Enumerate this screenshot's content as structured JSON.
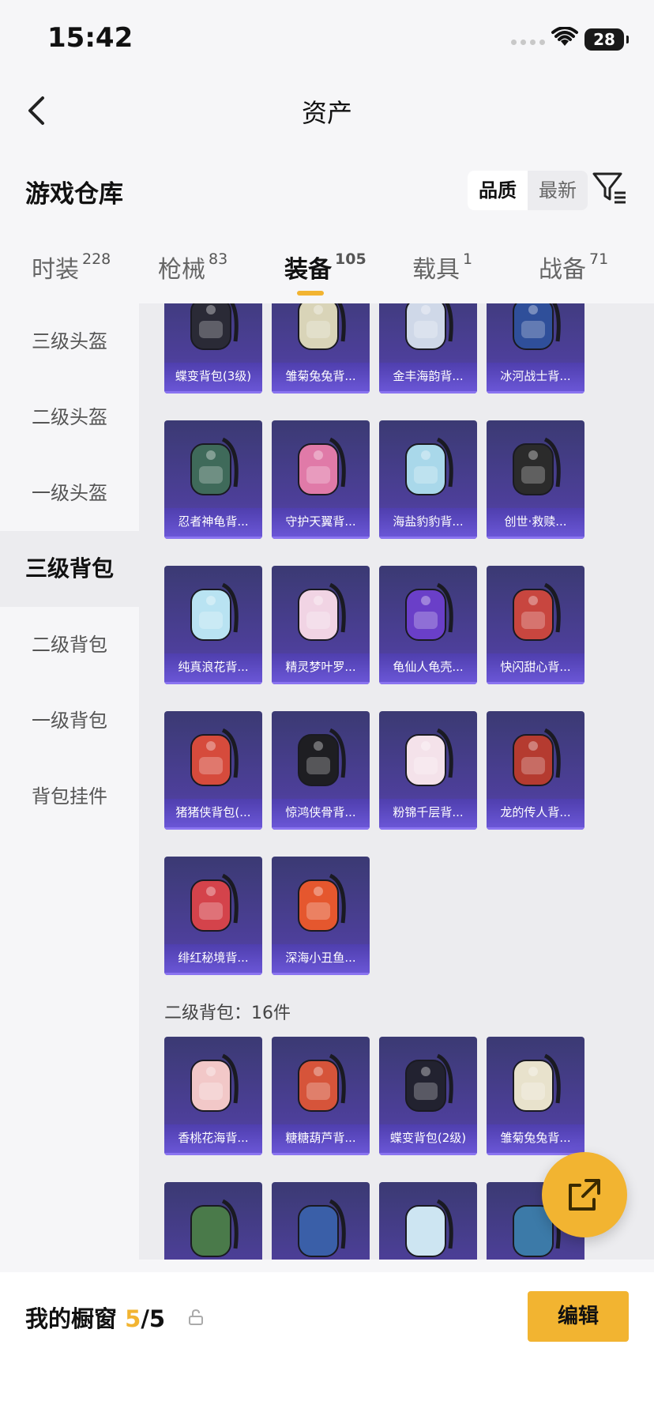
{
  "status_bar": {
    "time": "15:42",
    "battery": "28"
  },
  "nav": {
    "title": "资产"
  },
  "section": {
    "title": "游戏仓库",
    "sort_options": [
      "品质",
      "最新"
    ],
    "active_sort": "品质"
  },
  "tabs": [
    {
      "label": "时装",
      "count": "228"
    },
    {
      "label": "枪械",
      "count": "83"
    },
    {
      "label": "装备",
      "count": "105",
      "active": true
    },
    {
      "label": "载具",
      "count": "1"
    },
    {
      "label": "战备",
      "count": "71"
    }
  ],
  "side_menu": {
    "items": [
      "三级头盔",
      "二级头盔",
      "一级头盔",
      "三级背包",
      "二级背包",
      "一级背包",
      "背包挂件"
    ],
    "active": "三级背包"
  },
  "grid": {
    "level3_items": [
      "蝶变背包(3级)",
      "雏菊兔兔背...",
      "金丰海韵背...",
      "冰河战士背...",
      "忍者神龟背...",
      "守护天翼背...",
      "海盐豹豹背...",
      "创世·救赎...",
      "纯真浪花背...",
      "精灵梦叶罗...",
      "龟仙人龟壳...",
      "快闪甜心背...",
      "猪猪侠背包(...",
      "惊鸿侠骨背...",
      "粉锦千层背...",
      "龙的传人背...",
      "绯红秘境背...",
      "深海小丑鱼..."
    ],
    "level2_title": "二级背包：16件",
    "level2_items": [
      "香桃花海背...",
      "糖糖葫芦背...",
      "蝶变背包(2级)",
      "雏菊兔兔背..."
    ]
  },
  "art_colors": [
    "#2a2a36",
    "#d9d4b8",
    "#cfd8e8",
    "#2f4f9a",
    "#3f6a5a",
    "#e07aa8",
    "#a9d8ea",
    "#2b2b2b",
    "#b9e3f2",
    "#f1d4e4",
    "#6a3fc8",
    "#c8463f",
    "#d64b3c",
    "#1e1e22",
    "#f4e2ea",
    "#b53b30",
    "#d4434b",
    "#e5572e",
    "#f2c8c8",
    "#d6543a",
    "#222230",
    "#e8e2cc",
    "#4a7a4a",
    "#3a5fa8",
    "#cde5f2",
    "#3c7aa8"
  ],
  "fab": {
    "icon": "share-external-icon"
  },
  "bottom_bar": {
    "label": "我的橱窗",
    "current": "5",
    "total": "/5",
    "edit": "编辑"
  }
}
